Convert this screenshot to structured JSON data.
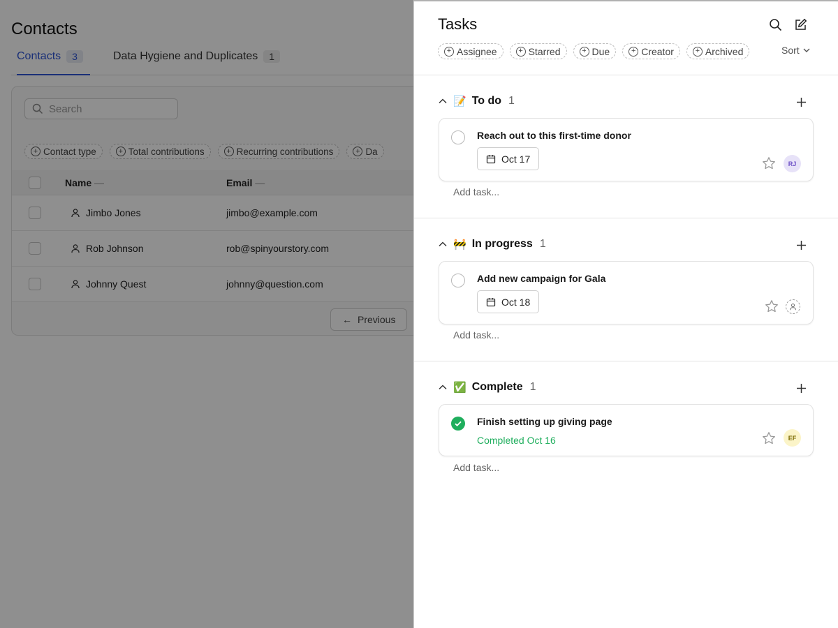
{
  "contacts_page": {
    "title": "Contacts",
    "tabs": [
      {
        "label": "Contacts",
        "count": "3"
      },
      {
        "label": "Data Hygiene and Duplicates",
        "count": "1"
      }
    ],
    "search_placeholder": "Search",
    "filters": [
      "Contact type",
      "Total contributions",
      "Recurring contributions",
      "Da"
    ],
    "columns": [
      "Name",
      "Email"
    ],
    "sort_indicator": "—",
    "rows": [
      {
        "name": "Jimbo Jones",
        "email": "jimbo@example.com"
      },
      {
        "name": "Rob Johnson",
        "email": "rob@spinyourstory.com"
      },
      {
        "name": "Johnny Quest",
        "email": "johnny@question.com"
      }
    ],
    "pager_previous": "Previous"
  },
  "tasks_panel": {
    "title": "Tasks",
    "filters": [
      "Assignee",
      "Starred",
      "Due",
      "Creator",
      "Archived"
    ],
    "sort_label": "Sort",
    "add_task_label": "Add task...",
    "sections": [
      {
        "emoji": "📝",
        "title": "To do",
        "count": "1",
        "task": {
          "title": "Reach out to this first-time donor",
          "due": "Oct 17",
          "avatar": "RJ"
        }
      },
      {
        "emoji": "🚧",
        "title": "In progress",
        "count": "1",
        "task": {
          "title": "Add new campaign for Gala",
          "due": "Oct 18",
          "avatar": ""
        }
      },
      {
        "emoji": "✅",
        "title": "Complete",
        "count": "1",
        "task": {
          "title": "Finish setting up giving page",
          "completed": "Completed Oct 16",
          "avatar": "EF"
        }
      }
    ]
  },
  "colors": {
    "accent": "#2f55d4",
    "success": "#1fae5d",
    "overlay": "rgba(0,0,0,0.44)"
  }
}
